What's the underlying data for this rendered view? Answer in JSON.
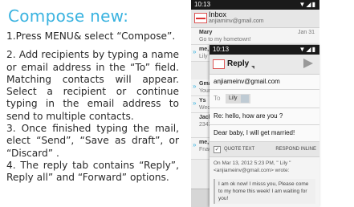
{
  "heading": "Compose new:",
  "steps": [
    "1.Press MENU& select “Compose”.",
    "2. Add recipients by typing a name or email address in the “To” field. Matching contacts will appear. Select a recipient or continue typing in the email address to send to multiple contacts.",
    "3. Once finished typing the mail, elect “Send”, “Save as draft”, or “Discard” .",
    "4. The reply tab contains “Reply”, Reply all” and “Forward” options."
  ],
  "back_phone": {
    "status_time": "10:13",
    "status_icons": "▼◢▮",
    "inbox_title": "Inbox",
    "account": "anjiaminv@gmail.com",
    "rows": [
      {
        "from": "Mary",
        "snippet": "Go to my hometown!",
        "date": "Jan 31"
      },
      {
        "from": "me, Y",
        "snippet": "Lily wil",
        "date": ""
      },
      {
        "from": "Gmail",
        "snippet": "Your G",
        "date": ""
      },
      {
        "from": "Ys",
        "snippet": "Weddin",
        "date": ""
      },
      {
        "from": "Jack ,",
        "snippet": "23435",
        "date": ""
      },
      {
        "from": "me, M",
        "snippet": "Fnag",
        "date": ""
      }
    ]
  },
  "front_phone": {
    "status_time": "10:13",
    "status_icons": "▼◢▮",
    "header_label": "Reply",
    "from_address": "anjiameinv@gmail.com",
    "to_label": "To",
    "to_chip": "Lily",
    "subject": "Re: hello, how are you ?",
    "body": "Dear baby, I will get married!",
    "quote_text_label": "QUOTE TEXT",
    "respond_inline_label": "RESPOND INLINE",
    "quote_header": "On Mar 13, 2012 5:23 PM, \" Lily \" <anjiameinv@gmail.com> wrote:",
    "quote_body": "I am ok now! I misss you, Please come to my home this week! I am waiting for you!"
  }
}
